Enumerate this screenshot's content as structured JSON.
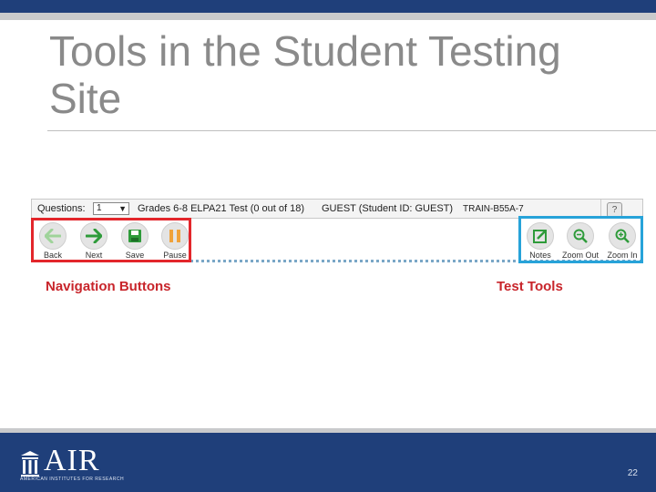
{
  "slide": {
    "title": "Tools in the Student Testing Site",
    "page_number": "22"
  },
  "screenshot": {
    "questions_label": "Questions:",
    "question_select_value": "1",
    "test_title": "Grades 6-8 ELPA21 Test (0 out of 18)",
    "student": "GUEST (Student ID: GUEST)",
    "session": "TRAIN-B55A-7",
    "help_label": "?",
    "nav_buttons": [
      {
        "label": "Back",
        "icon": "back-arrow-icon",
        "color": "#9fd39a"
      },
      {
        "label": "Next",
        "icon": "next-arrow-icon",
        "color": "#2e9b3a"
      },
      {
        "label": "Save",
        "icon": "save-icon",
        "color": "#2e9b3a"
      },
      {
        "label": "Pause",
        "icon": "pause-icon",
        "color": "#f0a23a"
      }
    ],
    "test_tools": [
      {
        "label": "Notes",
        "icon": "notes-icon",
        "color": "#2e9b3a"
      },
      {
        "label": "Zoom Out",
        "icon": "zoom-out-icon",
        "color": "#2e9b3a"
      },
      {
        "label": "Zoom In",
        "icon": "zoom-in-icon",
        "color": "#2e9b3a"
      }
    ]
  },
  "captions": {
    "navigation": "Navigation Buttons",
    "tools": "Test Tools"
  },
  "footer": {
    "logo_text": "AIR",
    "logo_subtitle": "AMERICAN INSTITUTES FOR RESEARCH"
  },
  "colors": {
    "header_blue": "#1f3f7a",
    "nav_frame": "#e3262b",
    "tools_frame": "#27a3d9",
    "caption_red": "#c8252b"
  }
}
